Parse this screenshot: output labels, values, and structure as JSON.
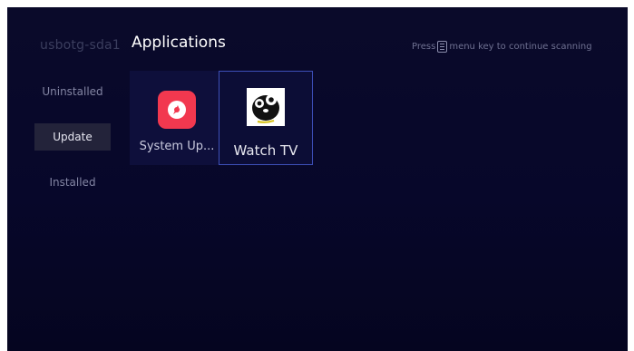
{
  "header": {
    "device_label": "usbotg-sda1",
    "title": "Applications",
    "hint_prefix": "Press",
    "hint_suffix": "menu key to  continue scanning"
  },
  "sidebar": {
    "items": [
      {
        "label": "Uninstalled",
        "active": false
      },
      {
        "label": "Update",
        "active": true
      },
      {
        "label": "Installed",
        "active": false
      }
    ]
  },
  "apps": [
    {
      "label": "System Up...",
      "icon": "system-update-icon",
      "focused": false
    },
    {
      "label": "Watch TV",
      "icon": "watch-tv-icon",
      "focused": true
    }
  ],
  "colors": {
    "background": "#07072a",
    "focus_border": "#3d4fb8",
    "system_update_icon": "#f2384f",
    "active_sidebar_bg": "#23233a"
  }
}
